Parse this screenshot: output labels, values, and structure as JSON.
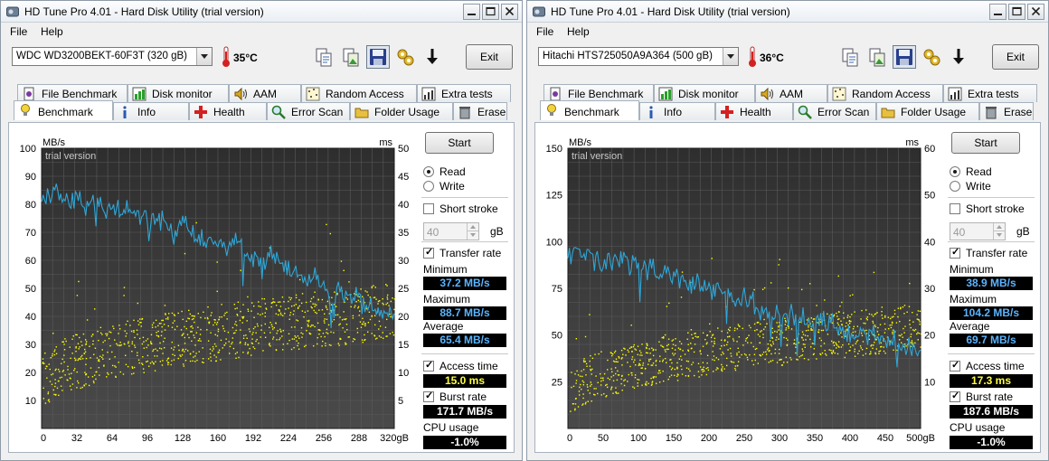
{
  "colors": {
    "chart_bg": "#3a3a3a",
    "grid": "#5a5a5a",
    "transfer_line": "#2ea6d8",
    "access_dots": "#ffff00",
    "value_blue": "#5ab4ff",
    "value_yellow": "#ffff40"
  },
  "icons": {
    "toolbar": [
      "copy-text-icon",
      "copy-image-icon",
      "save-icon",
      "options-icon",
      "download-icon"
    ],
    "tabs_row1": [
      "file-benchmark-icon",
      "disk-monitor-icon",
      "aam-speaker-icon",
      "random-access-icon",
      "extra-tests-icon"
    ],
    "tabs_row2": [
      "benchmark-bulb-icon",
      "info-icon",
      "health-cross-icon",
      "error-scan-magnifier-icon",
      "folder-icon",
      "erase-trash-icon"
    ]
  },
  "windows": [
    {
      "title": "HD Tune Pro 4.01 - Hard Disk Utility (trial version)",
      "menu": [
        "File",
        "Help"
      ],
      "drive": "WDC WD3200BEKT-60F3T    (320 gB)",
      "temperature": "35°C",
      "exit": "Exit",
      "tabs_row1": [
        "File Benchmark",
        "Disk monitor",
        "AAM",
        "Random Access",
        "Extra tests"
      ],
      "tabs_row2": [
        "Benchmark",
        "Info",
        "Health",
        "Error Scan",
        "Folder Usage",
        "Erase"
      ],
      "active_tab": "Benchmark",
      "side": {
        "start": "Start",
        "read": "Read",
        "write": "Write",
        "short_stroke": "Short stroke",
        "stroke_value": "40",
        "stroke_unit": "gB",
        "transfer_rate": "Transfer rate",
        "minimum_label": "Minimum",
        "minimum": "37.2 MB/s",
        "maximum_label": "Maximum",
        "maximum": "88.7 MB/s",
        "average_label": "Average",
        "average": "65.4 MB/s",
        "access_time_label": "Access time",
        "access_time": "15.0 ms",
        "burst_rate_label": "Burst rate",
        "burst_rate": "171.7 MB/s",
        "cpu_usage_label": "CPU usage",
        "cpu_usage": "-1.0%"
      },
      "chart_data": {
        "type": "line",
        "title": "",
        "watermark": "trial version",
        "ylabel_left": "MB/s",
        "ylabel_right": "ms",
        "x_unit": "gB",
        "xlim": [
          0,
          320
        ],
        "ylim_left": [
          0,
          100
        ],
        "ylim_right": [
          0,
          50
        ],
        "x_ticks": [
          "0",
          "32",
          "64",
          "96",
          "128",
          "160",
          "192",
          "224",
          "256",
          "288",
          "320gB"
        ],
        "y_left_ticks": [
          "100",
          "90",
          "80",
          "70",
          "60",
          "50",
          "40",
          "30",
          "20",
          "10"
        ],
        "y_right_ticks": [
          "50",
          "45",
          "40",
          "35",
          "30",
          "25",
          "20",
          "15",
          "10",
          "5"
        ],
        "series": [
          {
            "name": "Transfer rate",
            "axis": "left",
            "x": [
              0,
              8,
              16,
              24,
              32,
              40,
              48,
              56,
              64,
              72,
              80,
              88,
              96,
              104,
              112,
              120,
              128,
              136,
              144,
              152,
              160,
              168,
              176,
              184,
              192,
              200,
              208,
              216,
              224,
              232,
              240,
              248,
              256,
              264,
              272,
              280,
              288,
              296,
              304,
              312,
              320
            ],
            "values": [
              83,
              82,
              84,
              81,
              83,
              79,
              82,
              78,
              79,
              77,
              78,
              75,
              76,
              72,
              74,
              70,
              72,
              71,
              69,
              68,
              67,
              65,
              66,
              64,
              62,
              60,
              61,
              58,
              57,
              56,
              53,
              54,
              51,
              49,
              48,
              47,
              46,
              44,
              43,
              42,
              41
            ]
          },
          {
            "name": "Access time",
            "axis": "right",
            "type": "scatter",
            "trend": {
              "start_ms": 8,
              "end_ms": 21
            }
          }
        ]
      }
    },
    {
      "title": "HD Tune Pro 4.01 - Hard Disk Utility (trial version)",
      "menu": [
        "File",
        "Help"
      ],
      "drive": "Hitachi HTS725050A9A364 (500 gB)",
      "temperature": "36°C",
      "exit": "Exit",
      "tabs_row1": [
        "File Benchmark",
        "Disk monitor",
        "AAM",
        "Random Access",
        "Extra tests"
      ],
      "tabs_row2": [
        "Benchmark",
        "Info",
        "Health",
        "Error Scan",
        "Folder Usage",
        "Erase"
      ],
      "active_tab": "Benchmark",
      "side": {
        "start": "Start",
        "read": "Read",
        "write": "Write",
        "short_stroke": "Short stroke",
        "stroke_value": "40",
        "stroke_unit": "gB",
        "transfer_rate": "Transfer rate",
        "minimum_label": "Minimum",
        "minimum": "38.9 MB/s",
        "maximum_label": "Maximum",
        "maximum": "104.2 MB/s",
        "average_label": "Average",
        "average": "69.7 MB/s",
        "access_time_label": "Access time",
        "access_time": "17.3 ms",
        "burst_rate_label": "Burst rate",
        "burst_rate": "187.6 MB/s",
        "cpu_usage_label": "CPU usage",
        "cpu_usage": "-1.0%"
      },
      "chart_data": {
        "type": "line",
        "title": "",
        "watermark": "trial version",
        "ylabel_left": "MB/s",
        "ylabel_right": "ms",
        "x_unit": "gB",
        "xlim": [
          0,
          500
        ],
        "ylim_left": [
          0,
          150
        ],
        "ylim_right": [
          0,
          60
        ],
        "x_ticks": [
          "0",
          "50",
          "100",
          "150",
          "200",
          "250",
          "300",
          "350",
          "400",
          "450",
          "500gB"
        ],
        "y_left_ticks": [
          "150",
          "125",
          "100",
          "75",
          "50",
          "25"
        ],
        "y_right_ticks": [
          "60",
          "50",
          "40",
          "30",
          "20",
          "10"
        ],
        "series": [
          {
            "name": "Transfer rate",
            "axis": "left",
            "x": [
              0,
              12.5,
              25,
              37.5,
              50,
              62.5,
              75,
              87.5,
              100,
              112.5,
              125,
              137.5,
              150,
              162.5,
              175,
              187.5,
              200,
              212.5,
              225,
              237.5,
              250,
              262.5,
              275,
              287.5,
              300,
              312.5,
              325,
              337.5,
              350,
              362.5,
              375,
              387.5,
              400,
              412.5,
              425,
              437.5,
              450,
              462.5,
              475,
              487.5,
              500
            ],
            "values": [
              94,
              95,
              93,
              92,
              91,
              90,
              89,
              88,
              86,
              85,
              84,
              82,
              81,
              79,
              78,
              77,
              75,
              74,
              72,
              71,
              69,
              68,
              65,
              62,
              60,
              61,
              59,
              58,
              56,
              57,
              55,
              54,
              52,
              51,
              50,
              49,
              47,
              46,
              44,
              43,
              42
            ]
          },
          {
            "name": "Access time",
            "axis": "right",
            "type": "scatter",
            "trend": {
              "start_ms": 7,
              "end_ms": 22
            }
          }
        ]
      }
    }
  ]
}
